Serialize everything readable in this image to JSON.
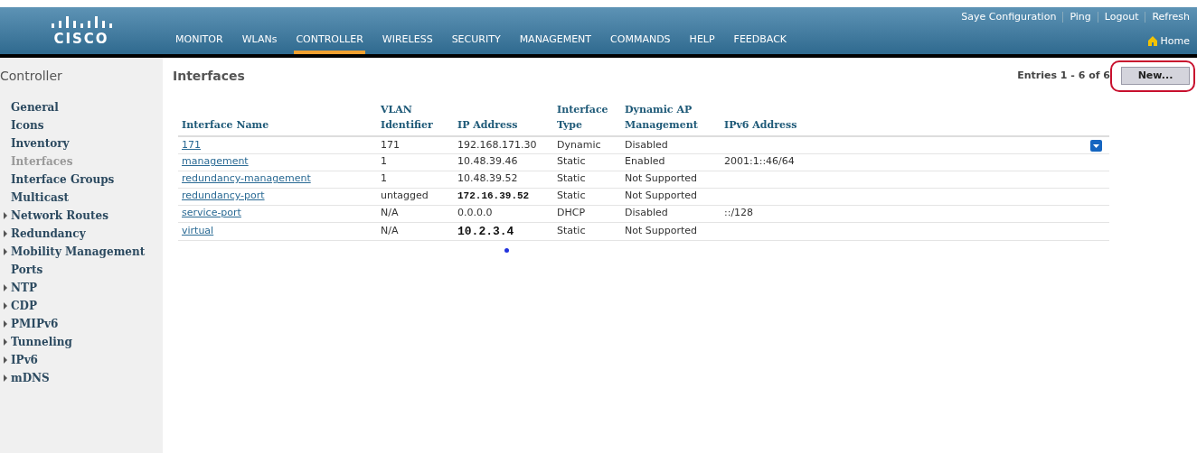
{
  "header": {
    "logo": "CISCO",
    "top_links": [
      "Saye Configuration",
      "Ping",
      "Logout",
      "Refresh"
    ],
    "home": "Home",
    "nav": [
      {
        "label": "MONITOR",
        "selected": false
      },
      {
        "label": "WLANs",
        "selected": false
      },
      {
        "label": "CONTROLLER",
        "selected": true
      },
      {
        "label": "WIRELESS",
        "selected": false
      },
      {
        "label": "SECURITY",
        "selected": false
      },
      {
        "label": "MANAGEMENT",
        "selected": false
      },
      {
        "label": "COMMANDS",
        "selected": false
      },
      {
        "label": "HELP",
        "selected": false
      },
      {
        "label": "FEEDBACK",
        "selected": false
      }
    ]
  },
  "sidebar": {
    "title": "Controller",
    "items": [
      {
        "label": "General",
        "expandable": false,
        "selected": false
      },
      {
        "label": "Icons",
        "expandable": false,
        "selected": false
      },
      {
        "label": "Inventory",
        "expandable": false,
        "selected": false
      },
      {
        "label": "Interfaces",
        "expandable": false,
        "selected": true
      },
      {
        "label": "Interface Groups",
        "expandable": false,
        "selected": false
      },
      {
        "label": "Multicast",
        "expandable": false,
        "selected": false
      },
      {
        "label": "Network Routes",
        "expandable": true,
        "selected": false
      },
      {
        "label": "Redundancy",
        "expandable": true,
        "selected": false
      },
      {
        "label": "Mobility Management",
        "expandable": true,
        "selected": false
      },
      {
        "label": "Ports",
        "expandable": false,
        "selected": false
      },
      {
        "label": "NTP",
        "expandable": true,
        "selected": false
      },
      {
        "label": "CDP",
        "expandable": true,
        "selected": false
      },
      {
        "label": "PMIPv6",
        "expandable": true,
        "selected": false
      },
      {
        "label": "Tunneling",
        "expandable": true,
        "selected": false
      },
      {
        "label": "IPv6",
        "expandable": true,
        "selected": false
      },
      {
        "label": "mDNS",
        "expandable": true,
        "selected": false
      }
    ]
  },
  "content": {
    "title": "Interfaces",
    "entries": "Entries 1 - 6 of 6",
    "new_button": "New...",
    "table": {
      "columns": [
        "Interface Name",
        "VLAN Identifier",
        "IP Address",
        "Interface Type",
        "Dynamic AP Management",
        "IPv6 Address"
      ],
      "rows": [
        {
          "name": "171",
          "vlan": "171",
          "ip": "192.168.171.30",
          "kind": "plain",
          "type": "Dynamic",
          "ap_management": "Disabled",
          "menu_button": true
        },
        {
          "name": "management",
          "vlan": "1",
          "ip": "10.48.39.46",
          "kind": "plain",
          "type": "Static",
          "ap_management": "Enabled",
          "ipv6": "2001:1::46/64",
          "menu_button": false
        },
        {
          "name": "redundancy-management",
          "vlan": "1",
          "ip": "10.48.39.52",
          "kind": "plain",
          "type": "Static",
          "ap_management": "Not Supported",
          "menu_button": false
        },
        {
          "name": "redundancy-port",
          "vlan": "untagged",
          "ip": "172.16.39.52",
          "kind": "mono",
          "type": "Static",
          "ap_management": "Not Supported",
          "menu_button": false
        },
        {
          "name": "service-port",
          "vlan": "N/A",
          "ip": "0.0.0.0",
          "kind": "plain",
          "type": "DHCP",
          "ap_management": "Disabled",
          "ipv6": "::/128",
          "menu_button": false
        },
        {
          "name": "virtual",
          "vlan": "N/A",
          "ip": "10.2.3.4",
          "kind": "mono-large",
          "type": "Static",
          "ap_management": "Not Supported",
          "menu_button": false
        }
      ]
    }
  }
}
